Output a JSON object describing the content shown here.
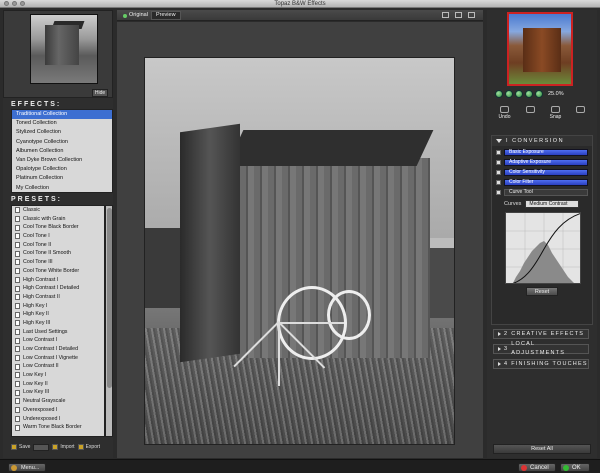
{
  "window": {
    "title": "Topaz B&W Effects"
  },
  "left_panel": {
    "hide_label": "Hide",
    "effects_title": "EFFECTS:",
    "effects": [
      "Traditional Collection",
      "Toned Collection",
      "Stylized Collection",
      "Cyanotype Collection",
      "Albumen Collection",
      "Van Dyke Brown Collection",
      "Opalotype Collection",
      "Platinum Collection",
      "My Collection"
    ],
    "effects_selected_index": 0,
    "presets_title": "PRESETS:",
    "presets": [
      "Classic",
      "Classic with Grain",
      "Cool Tone Black Border",
      "Cool Tone I",
      "Cool Tone II",
      "Cool Tone II Smooth",
      "Cool Tone III",
      "Cool Tone White Border",
      "High Contrast I",
      "High Contrast I Detailed",
      "High Contrast II",
      "High Key I",
      "High Key II",
      "High Key III",
      "Last Used Settings",
      "Low Contrast I",
      "Low Contrast I Detailed",
      "Low Contrast I Vignette",
      "Low Contrast II",
      "Low Key I",
      "Low Key II",
      "Low Key III",
      "Neutral Grayscale",
      "Overexposed I",
      "Underexposed I",
      "Warm Tone Black Border"
    ],
    "toolbar": {
      "save": "Save",
      "import": "Import",
      "export": "Export"
    }
  },
  "center": {
    "tab_original": "Original",
    "tab_preview": "Preview"
  },
  "right_panel": {
    "zoom": "25.0%",
    "undo_label": "Undo",
    "snap_label": "Snap",
    "conversion_title": "CONVERSION",
    "conversion_index": "I",
    "sections": {
      "basic_exposure": "Basic Exposure",
      "adaptive_exposure": "Adaptive Exposure",
      "color_sensitivity": "Color Sensitivity",
      "color_filter": "Color Filter",
      "curve_tool": "Curve Tool"
    },
    "curves_label": "Curves",
    "curves_value": "Medium Contrast",
    "reset_label": "Reset",
    "collapsed": [
      {
        "num": "2",
        "label": "CREATIVE EFFECTS"
      },
      {
        "num": "3",
        "label": "LOCAL ADJUSTMENTS"
      },
      {
        "num": "4",
        "label": "FINISHING TOUCHES"
      }
    ],
    "reset_all_label": "Reset All"
  },
  "bottom_bar": {
    "menu_label": "Menu...",
    "cancel_label": "Cancel",
    "ok_label": "OK"
  }
}
